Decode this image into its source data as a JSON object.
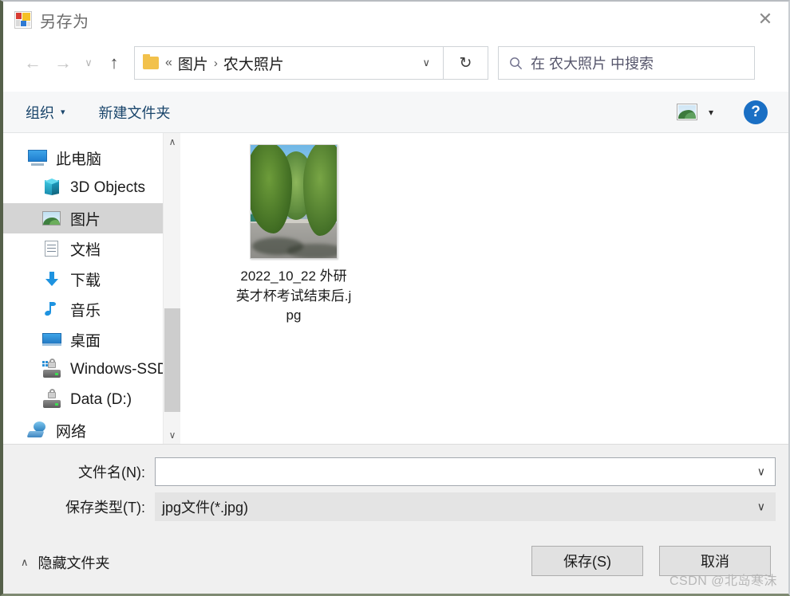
{
  "window": {
    "title": "另存为",
    "app_icon": "paint-app-icon",
    "close_label": "✕"
  },
  "nav": {
    "back_icon": "←",
    "forward_icon": "→",
    "history_icon": "∨",
    "up_icon": "↑",
    "refresh_icon": "↻",
    "address_chevron": "∨",
    "breadcrumb": {
      "prefix": "«",
      "items": [
        "图片",
        "农大照片"
      ],
      "separator": "›"
    }
  },
  "search": {
    "icon": "⚲",
    "placeholder": "在 农大照片 中搜索"
  },
  "toolbar": {
    "organize_label": "组织",
    "organize_caret": "▾",
    "new_folder_label": "新建文件夹",
    "view_caret": "▾",
    "help_label": "?"
  },
  "sidebar": {
    "items": [
      {
        "label": "此电脑",
        "icon": "monitor-icon",
        "level": 0,
        "selected": false
      },
      {
        "label": "3D Objects",
        "icon": "cube-icon",
        "level": 1,
        "selected": false
      },
      {
        "label": "图片",
        "icon": "picture-icon",
        "level": 1,
        "selected": true
      },
      {
        "label": "文档",
        "icon": "document-icon",
        "level": 1,
        "selected": false
      },
      {
        "label": "下载",
        "icon": "download-icon",
        "level": 1,
        "selected": false
      },
      {
        "label": "音乐",
        "icon": "music-icon",
        "level": 1,
        "selected": false
      },
      {
        "label": "桌面",
        "icon": "desktop-icon",
        "level": 1,
        "selected": false
      },
      {
        "label": "Windows-SSD",
        "icon": "drive-icon",
        "level": 1,
        "selected": false
      },
      {
        "label": "Data (D:)",
        "icon": "drive-icon",
        "level": 1,
        "selected": false
      },
      {
        "label": "网络",
        "icon": "network-icon",
        "level": 0,
        "selected": false
      }
    ],
    "scroll_up_icon": "∧",
    "scroll_down_icon": "∨"
  },
  "files": [
    {
      "name": "2022_10_22 外研英才杯考试结束后.jpg",
      "thumbnail": "tree-lined-road-photo"
    }
  ],
  "form": {
    "filename_label": "文件名(N):",
    "filename_value": "",
    "filename_chevron": "∨",
    "savetype_label": "保存类型(T):",
    "savetype_value": "jpg文件(*.jpg)",
    "savetype_chevron": "∨"
  },
  "footer": {
    "hide_folders_label": "隐藏文件夹",
    "hide_folders_chevron": "∧",
    "save_label": "保存(S)",
    "cancel_label": "取消"
  },
  "watermark": "CSDN @北岛寒沫",
  "colors": {
    "accent_blue": "#1a6fc4",
    "link_blue": "#19456b",
    "selection_grey": "#d4d4d4",
    "panel_grey": "#f0f0f0"
  }
}
